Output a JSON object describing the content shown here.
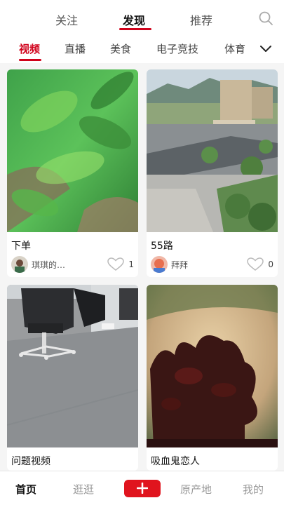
{
  "top_tabs": [
    {
      "label": "关注"
    },
    {
      "label": "发现"
    },
    {
      "label": "推荐"
    }
  ],
  "categories": [
    {
      "label": "视频"
    },
    {
      "label": "直播"
    },
    {
      "label": "美食"
    },
    {
      "label": "电子竞技"
    },
    {
      "label": "体育"
    }
  ],
  "cards": [
    {
      "title": "下单",
      "author": "琪琪的…",
      "likes": "1"
    },
    {
      "title": "55路",
      "author": "拜拜",
      "likes": "0"
    },
    {
      "title": "问题视频",
      "author": "",
      "likes": ""
    },
    {
      "title": "吸血鬼恋人",
      "author": "",
      "likes": ""
    }
  ],
  "bottom_nav": [
    {
      "label": "首页"
    },
    {
      "label": "逛逛"
    },
    {
      "label": "原产地"
    },
    {
      "label": "我的"
    }
  ],
  "colors": {
    "accent": "#d0021b",
    "plus_button": "#e0141e"
  },
  "icons": {
    "search": "search-icon",
    "more": "chevron-down-icon",
    "like": "heart-icon",
    "add": "plus-icon"
  }
}
